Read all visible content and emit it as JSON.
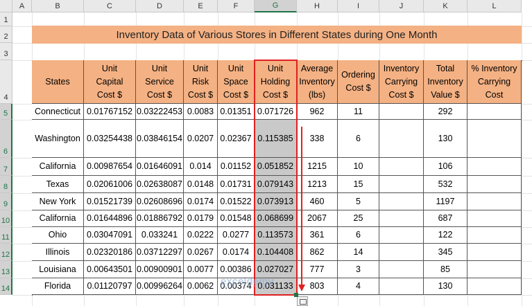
{
  "sheet": {
    "columns": [
      "A",
      "B",
      "C",
      "D",
      "E",
      "F",
      "G",
      "H",
      "I",
      "J",
      "K",
      "L"
    ],
    "selected_column": "G",
    "rows": [
      "1",
      "2",
      "3",
      "4",
      "5",
      "6",
      "7",
      "8",
      "9",
      "10",
      "11",
      "12",
      "13",
      "14"
    ],
    "selected_rows": [
      "5",
      "6",
      "7",
      "8",
      "9",
      "10",
      "11",
      "12",
      "13",
      "14"
    ]
  },
  "title": "Inventory Data of Various Stores in Different States during One Month",
  "table": {
    "headers": [
      [
        "States"
      ],
      [
        "Unit",
        "Capital",
        "Cost $"
      ],
      [
        "Unit",
        "Service",
        "Cost $"
      ],
      [
        "Unit",
        "Risk",
        "Cost $"
      ],
      [
        "Unit",
        "Space",
        "Cost $"
      ],
      [
        "Unit",
        "Holding",
        "Cost $"
      ],
      [
        "Average",
        "Inventory",
        "(lbs)"
      ],
      [
        "Ordering",
        "Cost $"
      ],
      [
        "Inventory",
        "Carrying",
        "Cost $"
      ],
      [
        "Total",
        "Inventory",
        "Value $"
      ],
      [
        "% Inventory",
        "Carrying",
        "Cost"
      ]
    ],
    "rows": [
      [
        "Connecticut",
        "0.01767152",
        "0.03222453",
        "0.0083",
        "0.01351",
        "0.071726",
        "962",
        "11",
        "",
        "292",
        ""
      ],
      [
        "Washington",
        "0.03254438",
        "0.03846154",
        "0.0207",
        "0.02367",
        "0.115385",
        "338",
        "6",
        "",
        "130",
        ""
      ],
      [
        "California",
        "0.00987654",
        "0.01646091",
        "0.014",
        "0.01152",
        "0.051852",
        "1215",
        "10",
        "",
        "106",
        ""
      ],
      [
        "Texas",
        "0.02061006",
        "0.02638087",
        "0.0148",
        "0.01731",
        "0.079143",
        "1213",
        "15",
        "",
        "532",
        ""
      ],
      [
        "New York",
        "0.01521739",
        "0.02608696",
        "0.0174",
        "0.01522",
        "0.073913",
        "460",
        "5",
        "",
        "1197",
        ""
      ],
      [
        "California",
        "0.01644896",
        "0.01886792",
        "0.0179",
        "0.01548",
        "0.068699",
        "2067",
        "25",
        "",
        "687",
        ""
      ],
      [
        "Ohio",
        "0.03047091",
        "0.033241",
        "0.0222",
        "0.0277",
        "0.113573",
        "361",
        "6",
        "",
        "122",
        ""
      ],
      [
        "Illinois",
        "0.02320186",
        "0.03712297",
        "0.0267",
        "0.0174",
        "0.104408",
        "862",
        "14",
        "",
        "345",
        ""
      ],
      [
        "Louisiana",
        "0.00643501",
        "0.00900901",
        "0.0077",
        "0.00386",
        "0.027027",
        "777",
        "3",
        "",
        "85",
        ""
      ],
      [
        "Florida",
        "0.01120797",
        "0.00996264",
        "0.0062",
        "0.00374",
        "0.031133",
        "803",
        "4",
        "",
        "130",
        ""
      ]
    ]
  },
  "watermark": {
    "brand": "exceldemy",
    "tagline": "EXCEL · DATA · BI"
  },
  "colors": {
    "header_fill": "#f4b183",
    "selection_fill": "#c9c9c9",
    "selection_border": "#e02020",
    "excel_green": "#217346"
  }
}
